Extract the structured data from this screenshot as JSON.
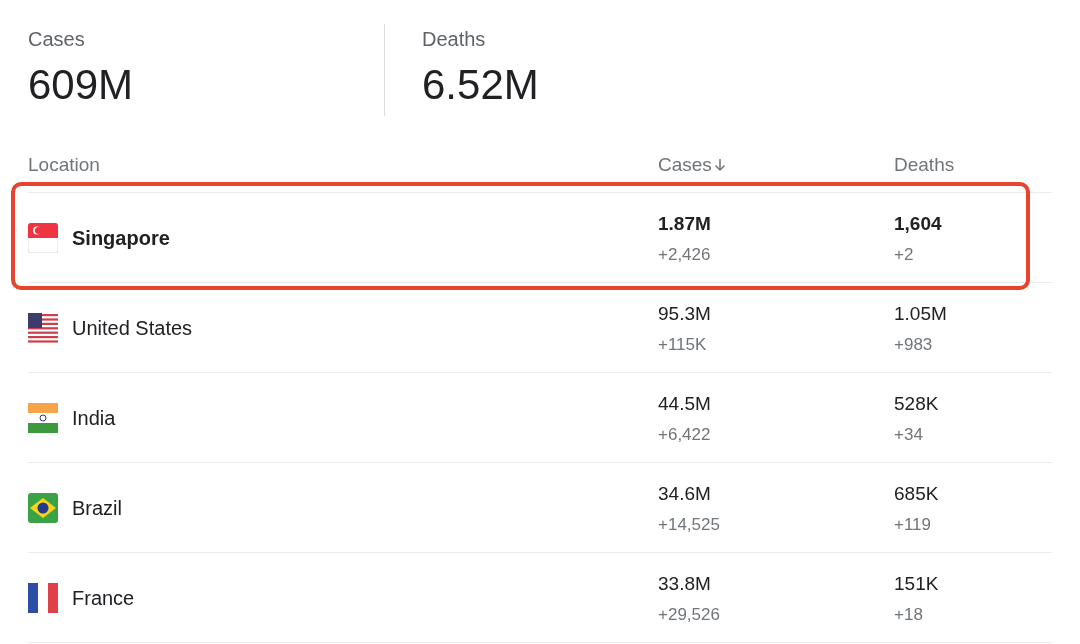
{
  "summary": [
    {
      "label": "Cases",
      "value": "609M"
    },
    {
      "label": "Deaths",
      "value": "6.52M"
    }
  ],
  "table": {
    "columns": [
      {
        "label": "Location",
        "sorted": false
      },
      {
        "label": "Cases",
        "sorted": true
      },
      {
        "label": "Deaths",
        "sorted": false
      }
    ],
    "rows": [
      {
        "kind": "singapore",
        "location": "Singapore",
        "cases": "1.87M",
        "cases_change": "+2,426",
        "deaths": "1,604",
        "deaths_change": "+2",
        "highlighted": true
      },
      {
        "kind": "usa",
        "location": "United States",
        "cases": "95.3M",
        "cases_change": "+115K",
        "deaths": "1.05M",
        "deaths_change": "+983",
        "highlighted": false
      },
      {
        "kind": "india",
        "location": "India",
        "cases": "44.5M",
        "cases_change": "+6,422",
        "deaths": "528K",
        "deaths_change": "+34",
        "highlighted": false
      },
      {
        "kind": "brazil",
        "location": "Brazil",
        "cases": "34.6M",
        "cases_change": "+14,525",
        "deaths": "685K",
        "deaths_change": "+119",
        "highlighted": false
      },
      {
        "kind": "france",
        "location": "France",
        "cases": "33.8M",
        "cases_change": "+29,526",
        "deaths": "151K",
        "deaths_change": "+18",
        "highlighted": false
      }
    ]
  }
}
